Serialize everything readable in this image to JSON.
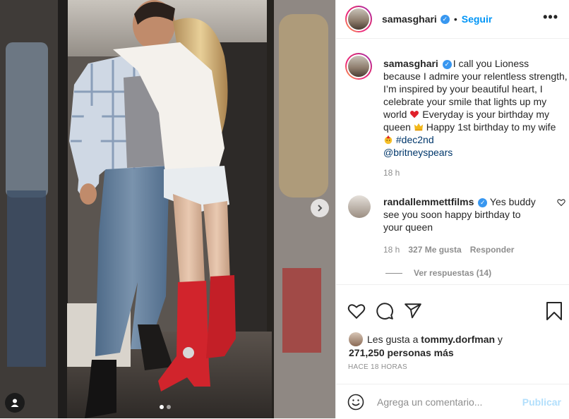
{
  "post": {
    "username": "samasghari",
    "separator": "•",
    "follow_label": "Seguir",
    "more_label": "•••"
  },
  "caption": {
    "username": "samasghari",
    "text_parts": [
      "I call you Lioness because I admire your relentless strength, I’m inspired by your beautiful heart, I celebrate your smile that lights up my world ",
      " Everyday is your birthday my queen ",
      " Happy 1st birthday to my wife ",
      " "
    ],
    "hashtag": "#dec2nd",
    "mention": "@britneyspears",
    "time": "18 h",
    "emojis": [
      "heart-emoji",
      "crown-emoji",
      "party-face-emoji"
    ]
  },
  "comment": {
    "username": "randallemmettfilms",
    "text": "Yes buddy see you soon happy birthday to your queen",
    "time": "18 h",
    "likes": "327 Me gusta",
    "reply_label": "Responder",
    "view_replies": "Ver respuestas (14)"
  },
  "actions": {
    "icons": [
      "heart-icon",
      "comment-icon",
      "share-icon",
      "bookmark-icon"
    ]
  },
  "likes": {
    "prefix": "Les gusta a ",
    "user": "tommy.dorfman",
    "middle": " y",
    "count": "271,250 personas más"
  },
  "timestamp": "HACE 18 HORAS",
  "composer": {
    "placeholder": "Agrega un comentario...",
    "publish_label": "Publicar"
  },
  "carousel": {
    "slides": 2,
    "active": 0
  },
  "colors": {
    "accent": "#0095f6",
    "verified": "#3897f0",
    "publish_disabled": "#b2dffc",
    "muted": "#8e8e8e",
    "text": "#262626"
  }
}
